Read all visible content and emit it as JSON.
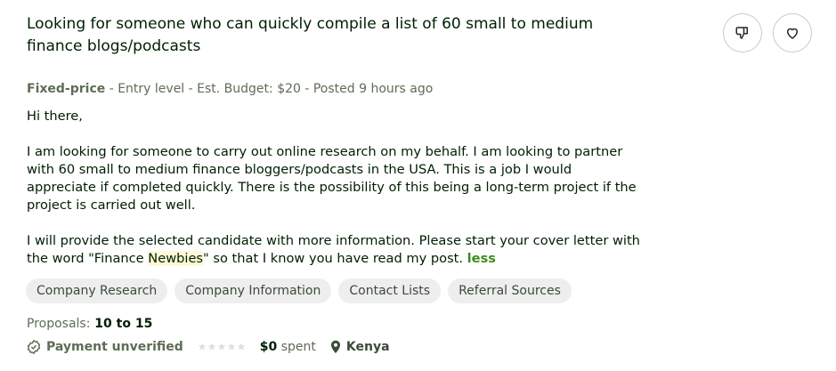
{
  "job": {
    "title_line1": "Looking for someone who can quickly compile a list of 60 small to medium",
    "title_line2": "finance blogs/podcasts",
    "type": "Fixed-price",
    "meta_rest": " - Entry level - Est. Budget: $20 - Posted 9 hours ago",
    "description": {
      "greeting": "Hi there,",
      "p2_l1": "I am looking for someone to carry out online research on my behalf. I am looking to partner",
      "p2_l2": "with 60 small to medium finance bloggers/podcasts in the USA. This is a job I would",
      "p2_l3": "appreciate if completed quickly. There is the possibility of this being a long-term project if the",
      "p2_l4": "project is carried out well.",
      "p3_l1": "I will provide the selected candidate with more information. Please start your cover letter with",
      "p3_l2_before": "the word \"Finance ",
      "p3_l2_highlight": "Newbies",
      "p3_l2_after": "\" so that I know you have read my post. ",
      "less_link": "less"
    },
    "tags": [
      "Company Research",
      "Company Information",
      "Contact Lists",
      "Referral Sources"
    ],
    "proposals_label": "Proposals:",
    "proposals_value": " 10 to 15",
    "payment_status": "Payment unverified",
    "rating_stars": 0,
    "spent_amount": "$0",
    "spent_label": " spent",
    "location": "Kenya"
  },
  "actions": {
    "dislike_icon": "thumbs-down-icon",
    "save_icon": "heart-icon"
  },
  "colors": {
    "link_green": "#3e8c1b",
    "highlight": "#fdf9d7",
    "tag_bg": "#eeeeee"
  }
}
